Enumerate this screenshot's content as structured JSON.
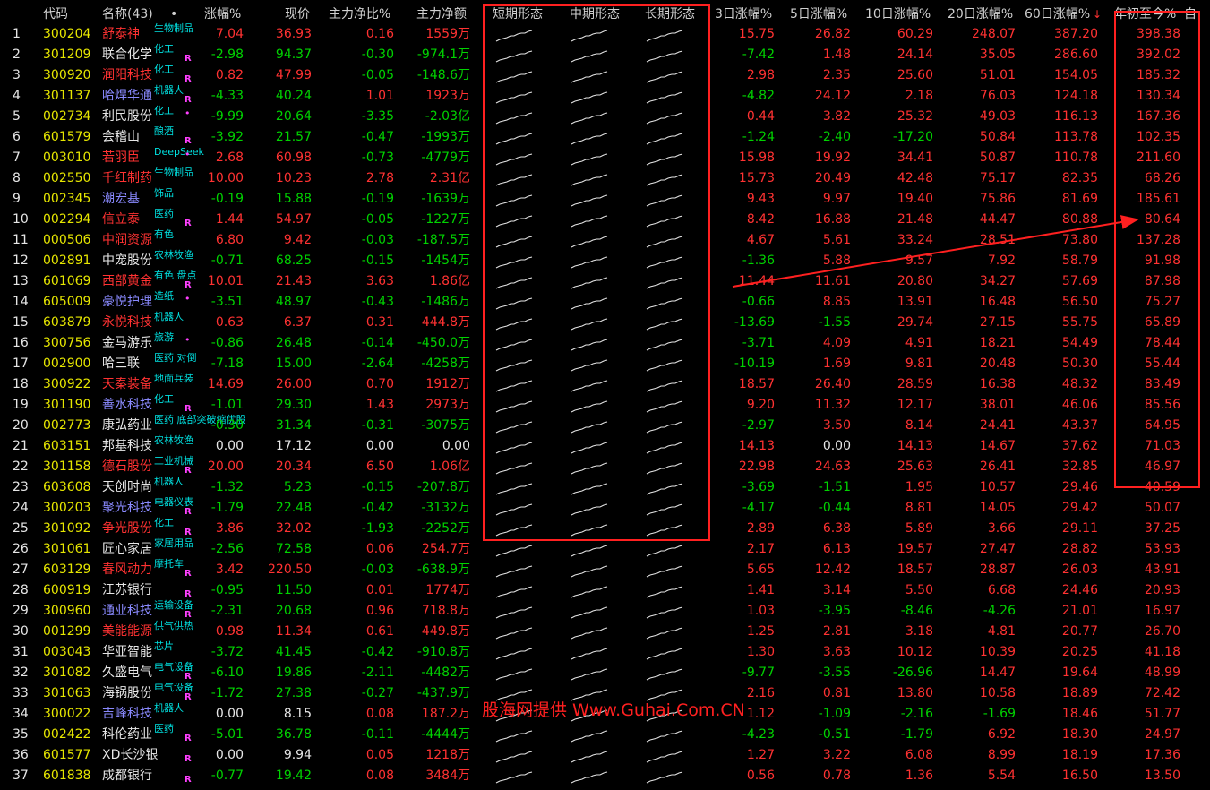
{
  "header": {
    "code": "代码",
    "name": "名称(43)",
    "dot": "•",
    "change": "涨幅%",
    "price": "现价",
    "main_ratio": "主力净比%",
    "main_net": "主力净额",
    "short_shape": "短期形态",
    "mid_shape": "中期形态",
    "long_shape": "长期形态",
    "d3": "3日涨幅%",
    "d5": "5日涨幅%",
    "d10": "10日涨幅%",
    "d20": "20日涨幅%",
    "d60": "60日涨幅%",
    "sort_arrow": "↓",
    "ytd": "年初至今%",
    "extra": "自"
  },
  "watermark": "股海网提供 Www.Guhai.Com.CN",
  "colors": {
    "red": "#ff3232",
    "green": "#00d200",
    "cyan": "#00e0e0",
    "magenta": "#ff40ff",
    "highlight_box": "#ff2020"
  },
  "rows": [
    {
      "idx": "1",
      "code": "300204",
      "name": "舒泰神",
      "tag": "生物制品",
      "r": "",
      "change": "7.04",
      "price": "36.93",
      "ratio": "0.16",
      "net": "1559万",
      "d3": "15.75",
      "d5": "26.82",
      "d10": "60.29",
      "d20": "248.07",
      "d60": "387.20",
      "ytd": "398.38"
    },
    {
      "idx": "2",
      "code": "301209",
      "name": "联合化学",
      "tag": "化工",
      "r": "R",
      "change": "-2.98",
      "price": "94.37",
      "ratio": "-0.30",
      "net": "-974.1万",
      "d3": "-7.42",
      "d5": "1.48",
      "d10": "24.14",
      "d20": "35.05",
      "d60": "286.60",
      "ytd": "392.02"
    },
    {
      "idx": "3",
      "code": "300920",
      "name": "润阳科技",
      "tag": "化工",
      "r": "R",
      "change": "0.82",
      "price": "47.99",
      "ratio": "-0.05",
      "net": "-148.6万",
      "d3": "2.98",
      "d5": "2.35",
      "d10": "25.60",
      "d20": "51.01",
      "d60": "154.05",
      "ytd": "185.32"
    },
    {
      "idx": "4",
      "code": "301137",
      "name": "哈焊华通",
      "tag": "机器人",
      "r": "R",
      "change": "-4.33",
      "price": "40.24",
      "ratio": "1.01",
      "net": "1923万",
      "d3": "-4.82",
      "d5": "24.12",
      "d10": "2.18",
      "d20": "76.03",
      "d60": "124.18",
      "ytd": "130.34"
    },
    {
      "idx": "5",
      "code": "002734",
      "name": "利民股份",
      "tag": "化工",
      "r": "•",
      "change": "-9.99",
      "price": "20.64",
      "ratio": "-3.35",
      "net": "-2.03亿",
      "d3": "0.44",
      "d5": "3.82",
      "d10": "25.32",
      "d20": "49.03",
      "d60": "116.13",
      "ytd": "167.36"
    },
    {
      "idx": "6",
      "code": "601579",
      "name": "会稽山",
      "tag": "酿酒",
      "r": "R",
      "change": "-3.92",
      "price": "21.57",
      "ratio": "-0.47",
      "net": "-1993万",
      "d3": "-1.24",
      "d5": "-2.40",
      "d10": "-17.20",
      "d20": "50.84",
      "d60": "113.78",
      "ytd": "102.35"
    },
    {
      "idx": "7",
      "code": "003010",
      "name": "若羽臣",
      "tag": "DeepSeek",
      "r": "•",
      "change": "2.68",
      "price": "60.98",
      "ratio": "-0.73",
      "net": "-4779万",
      "d3": "15.98",
      "d5": "19.92",
      "d10": "34.41",
      "d20": "50.87",
      "d60": "110.78",
      "ytd": "211.60"
    },
    {
      "idx": "8",
      "code": "002550",
      "name": "千红制药",
      "tag": "生物制品",
      "r": "",
      "change": "10.00",
      "price": "10.23",
      "ratio": "2.78",
      "net": "2.31亿",
      "d3": "15.73",
      "d5": "20.49",
      "d10": "42.48",
      "d20": "75.17",
      "d60": "82.35",
      "ytd": "68.26"
    },
    {
      "idx": "9",
      "code": "002345",
      "name": "潮宏基",
      "tag": "饰品",
      "r": "",
      "change": "-0.19",
      "price": "15.88",
      "ratio": "-0.19",
      "net": "-1639万",
      "d3": "9.43",
      "d5": "9.97",
      "d10": "19.40",
      "d20": "75.86",
      "d60": "81.69",
      "ytd": "185.61"
    },
    {
      "idx": "10",
      "code": "002294",
      "name": "信立泰",
      "tag": "医药",
      "r": "R",
      "change": "1.44",
      "price": "54.97",
      "ratio": "-0.05",
      "net": "-1227万",
      "d3": "8.42",
      "d5": "16.88",
      "d10": "21.48",
      "d20": "44.47",
      "d60": "80.88",
      "ytd": "80.64"
    },
    {
      "idx": "11",
      "code": "000506",
      "name": "中润资源",
      "tag": "有色",
      "r": "",
      "change": "6.80",
      "price": "9.42",
      "ratio": "-0.03",
      "net": "-187.5万",
      "d3": "4.67",
      "d5": "5.61",
      "d10": "33.24",
      "d20": "28.51",
      "d60": "73.80",
      "ytd": "137.28"
    },
    {
      "idx": "12",
      "code": "002891",
      "name": "中宠股份",
      "tag": "农林牧渔",
      "r": "",
      "change": "-0.71",
      "price": "68.25",
      "ratio": "-0.15",
      "net": "-1454万",
      "d3": "-1.36",
      "d5": "5.88",
      "d10": "9.57",
      "d20": "7.92",
      "d60": "58.79",
      "ytd": "91.98"
    },
    {
      "idx": "13",
      "code": "601069",
      "name": "西部黄金",
      "tag": "有色 盘点",
      "r": "R",
      "change": "10.01",
      "price": "21.43",
      "ratio": "3.63",
      "net": "1.86亿",
      "d3": "11.44",
      "d5": "11.61",
      "d10": "20.80",
      "d20": "34.27",
      "d60": "57.69",
      "ytd": "87.98"
    },
    {
      "idx": "14",
      "code": "605009",
      "name": "豪悦护理",
      "tag": "造纸",
      "r": "•",
      "change": "-3.51",
      "price": "48.97",
      "ratio": "-0.43",
      "net": "-1486万",
      "d3": "-0.66",
      "d5": "8.85",
      "d10": "13.91",
      "d20": "16.48",
      "d60": "56.50",
      "ytd": "75.27"
    },
    {
      "idx": "15",
      "code": "603879",
      "name": "永悦科技",
      "tag": "机器人",
      "r": "",
      "change": "0.63",
      "price": "6.37",
      "ratio": "0.31",
      "net": "444.8万",
      "d3": "-13.69",
      "d5": "-1.55",
      "d10": "29.74",
      "d20": "27.15",
      "d60": "55.75",
      "ytd": "65.89"
    },
    {
      "idx": "16",
      "code": "300756",
      "name": "金马游乐",
      "tag": "旅游",
      "r": "•",
      "change": "-0.86",
      "price": "26.48",
      "ratio": "-0.14",
      "net": "-450.0万",
      "d3": "-3.71",
      "d5": "4.09",
      "d10": "4.91",
      "d20": "18.21",
      "d60": "54.49",
      "ytd": "78.44"
    },
    {
      "idx": "17",
      "code": "002900",
      "name": "哈三联",
      "tag": "医药 对倒",
      "r": "",
      "change": "-7.18",
      "price": "15.00",
      "ratio": "-2.64",
      "net": "-4258万",
      "d3": "-10.19",
      "d5": "1.69",
      "d10": "9.81",
      "d20": "20.48",
      "d60": "50.30",
      "ytd": "55.44"
    },
    {
      "idx": "18",
      "code": "300922",
      "name": "天秦装备",
      "tag": "地面兵装",
      "r": "",
      "change": "14.69",
      "price": "26.00",
      "ratio": "0.70",
      "net": "1912万",
      "d3": "18.57",
      "d5": "26.40",
      "d10": "28.59",
      "d20": "16.38",
      "d60": "48.32",
      "ytd": "83.49"
    },
    {
      "idx": "19",
      "code": "301190",
      "name": "善水科技",
      "tag": "化工",
      "r": "R",
      "change": "-1.01",
      "price": "29.30",
      "ratio": "1.43",
      "net": "2973万",
      "d3": "9.20",
      "d5": "11.32",
      "d10": "12.17",
      "d20": "38.01",
      "d60": "46.06",
      "ytd": "85.56"
    },
    {
      "idx": "20",
      "code": "002773",
      "name": "康弘药业",
      "tag": "医药 底部突破缩优股",
      "r": "",
      "change": "-0.30",
      "price": "31.34",
      "ratio": "-0.31",
      "net": "-3075万",
      "d3": "-2.97",
      "d5": "3.50",
      "d10": "8.14",
      "d20": "24.41",
      "d60": "43.37",
      "ytd": "64.95"
    },
    {
      "idx": "21",
      "code": "603151",
      "name": "邦基科技",
      "tag": "农林牧渔",
      "r": "",
      "change": "0.00",
      "price": "17.12",
      "ratio": "0.00",
      "net": "0.00",
      "d3": "14.13",
      "d5": "0.00",
      "d10": "14.13",
      "d20": "14.67",
      "d60": "37.62",
      "ytd": "71.03"
    },
    {
      "idx": "22",
      "code": "301158",
      "name": "德石股份",
      "tag": "工业机械",
      "r": "R",
      "change": "20.00",
      "price": "20.34",
      "ratio": "6.50",
      "net": "1.06亿",
      "d3": "22.98",
      "d5": "24.63",
      "d10": "25.63",
      "d20": "26.41",
      "d60": "32.85",
      "ytd": "46.97"
    },
    {
      "idx": "23",
      "code": "603608",
      "name": "天创时尚",
      "tag": "机器人",
      "r": "",
      "change": "-1.32",
      "price": "5.23",
      "ratio": "-0.15",
      "net": "-207.8万",
      "d3": "-3.69",
      "d5": "-1.51",
      "d10": "1.95",
      "d20": "10.57",
      "d60": "29.46",
      "ytd": "40.59"
    },
    {
      "idx": "24",
      "code": "300203",
      "name": "聚光科技",
      "tag": "电器仪表",
      "r": "R",
      "change": "-1.79",
      "price": "22.48",
      "ratio": "-0.42",
      "net": "-3132万",
      "d3": "-4.17",
      "d5": "-0.44",
      "d10": "8.81",
      "d20": "14.05",
      "d60": "29.42",
      "ytd": "50.07"
    },
    {
      "idx": "25",
      "code": "301092",
      "name": "争光股份",
      "tag": "化工",
      "r": "R",
      "change": "3.86",
      "price": "32.02",
      "ratio": "-1.93",
      "net": "-2252万",
      "d3": "2.89",
      "d5": "6.38",
      "d10": "5.89",
      "d20": "3.66",
      "d60": "29.11",
      "ytd": "37.25"
    },
    {
      "idx": "26",
      "code": "301061",
      "name": "匠心家居",
      "tag": "家居用品",
      "r": "",
      "change": "-2.56",
      "price": "72.58",
      "ratio": "0.06",
      "net": "254.7万",
      "d3": "2.17",
      "d5": "6.13",
      "d10": "19.57",
      "d20": "27.47",
      "d60": "28.82",
      "ytd": "53.93"
    },
    {
      "idx": "27",
      "code": "603129",
      "name": "春风动力",
      "tag": "摩托车",
      "r": "R",
      "change": "3.42",
      "price": "220.50",
      "ratio": "-0.03",
      "net": "-638.9万",
      "d3": "5.65",
      "d5": "12.42",
      "d10": "18.57",
      "d20": "28.87",
      "d60": "26.03",
      "ytd": "43.91"
    },
    {
      "idx": "28",
      "code": "600919",
      "name": "江苏银行",
      "tag": "",
      "r": "R",
      "change": "-0.95",
      "price": "11.50",
      "ratio": "0.01",
      "net": "1774万",
      "d3": "1.41",
      "d5": "3.14",
      "d10": "5.50",
      "d20": "6.68",
      "d60": "24.46",
      "ytd": "20.93"
    },
    {
      "idx": "29",
      "code": "300960",
      "name": "通业科技",
      "tag": "运输设备",
      "r": "R",
      "change": "-2.31",
      "price": "20.68",
      "ratio": "0.96",
      "net": "718.8万",
      "d3": "1.03",
      "d5": "-3.95",
      "d10": "-8.46",
      "d20": "-4.26",
      "d60": "21.01",
      "ytd": "16.97"
    },
    {
      "idx": "30",
      "code": "001299",
      "name": "美能能源",
      "tag": "供气供热",
      "r": "",
      "change": "0.98",
      "price": "11.34",
      "ratio": "0.61",
      "net": "449.8万",
      "d3": "1.25",
      "d5": "2.81",
      "d10": "3.18",
      "d20": "4.81",
      "d60": "20.77",
      "ytd": "26.70"
    },
    {
      "idx": "31",
      "code": "003043",
      "name": "华亚智能",
      "tag": "芯片",
      "r": "",
      "change": "-3.72",
      "price": "41.45",
      "ratio": "-0.42",
      "net": "-910.8万",
      "d3": "1.30",
      "d5": "3.63",
      "d10": "10.12",
      "d20": "10.39",
      "d60": "20.25",
      "ytd": "41.18"
    },
    {
      "idx": "32",
      "code": "301082",
      "name": "久盛电气",
      "tag": "电气设备",
      "r": "R",
      "change": "-6.10",
      "price": "19.86",
      "ratio": "-2.11",
      "net": "-4482万",
      "d3": "-9.77",
      "d5": "-3.55",
      "d10": "-26.96",
      "d20": "14.47",
      "d60": "19.64",
      "ytd": "48.99"
    },
    {
      "idx": "33",
      "code": "301063",
      "name": "海锅股份",
      "tag": "电气设备",
      "r": "R",
      "change": "-1.72",
      "price": "27.38",
      "ratio": "-0.27",
      "net": "-437.9万",
      "d3": "2.16",
      "d5": "0.81",
      "d10": "13.80",
      "d20": "10.58",
      "d60": "18.89",
      "ytd": "72.42"
    },
    {
      "idx": "34",
      "code": "300022",
      "name": "吉峰科技",
      "tag": "机器人",
      "r": "",
      "change": "0.00",
      "price": "8.15",
      "ratio": "0.08",
      "net": "187.2万",
      "d3": "1.12",
      "d5": "-1.09",
      "d10": "-2.16",
      "d20": "-1.69",
      "d60": "18.46",
      "ytd": "51.77"
    },
    {
      "idx": "35",
      "code": "002422",
      "name": "科伦药业",
      "tag": "医药",
      "r": "R",
      "change": "-5.01",
      "price": "36.78",
      "ratio": "-0.11",
      "net": "-4444万",
      "d3": "-4.23",
      "d5": "-0.51",
      "d10": "-1.79",
      "d20": "6.92",
      "d60": "18.30",
      "ytd": "24.97"
    },
    {
      "idx": "36",
      "code": "601577",
      "name": "XD长沙银",
      "tag": "",
      "r": "R",
      "change": "0.00",
      "price": "9.94",
      "ratio": "0.05",
      "net": "1218万",
      "d3": "1.27",
      "d5": "3.22",
      "d10": "6.08",
      "d20": "8.99",
      "d60": "18.19",
      "ytd": "17.36"
    },
    {
      "idx": "37",
      "code": "601838",
      "name": "成都银行",
      "tag": "",
      "r": "R",
      "change": "-0.77",
      "price": "19.42",
      "ratio": "0.08",
      "net": "3484万",
      "d3": "0.56",
      "d5": "0.78",
      "d10": "1.36",
      "d20": "5.54",
      "d60": "16.50",
      "ytd": "13.50"
    }
  ]
}
